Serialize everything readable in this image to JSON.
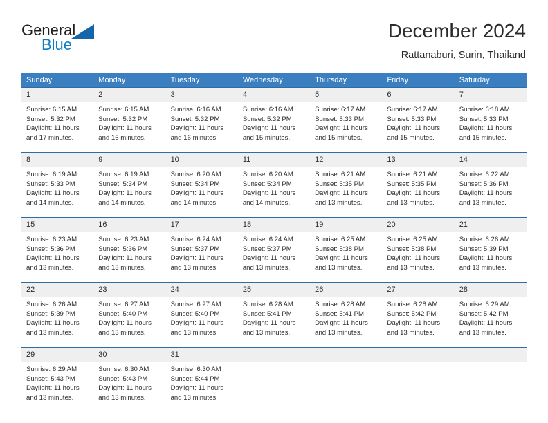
{
  "brand": {
    "line1": "General",
    "line2": "Blue",
    "accent_color": "#1565ab",
    "text_color": "#0f7dc2"
  },
  "header": {
    "title": "December 2024",
    "location": "Rattanaburi, Surin, Thailand"
  },
  "theme": {
    "header_bar_color": "#3b7fc0",
    "row_divider_color": "#2e6da4",
    "daynum_band_color": "#efefef"
  },
  "calendar": {
    "weekday_headers": [
      "Sunday",
      "Monday",
      "Tuesday",
      "Wednesday",
      "Thursday",
      "Friday",
      "Saturday"
    ],
    "weeks": [
      [
        {
          "day": "1",
          "sunrise": "Sunrise: 6:15 AM",
          "sunset": "Sunset: 5:32 PM",
          "daylight1": "Daylight: 11 hours",
          "daylight2": "and 17 minutes."
        },
        {
          "day": "2",
          "sunrise": "Sunrise: 6:15 AM",
          "sunset": "Sunset: 5:32 PM",
          "daylight1": "Daylight: 11 hours",
          "daylight2": "and 16 minutes."
        },
        {
          "day": "3",
          "sunrise": "Sunrise: 6:16 AM",
          "sunset": "Sunset: 5:32 PM",
          "daylight1": "Daylight: 11 hours",
          "daylight2": "and 16 minutes."
        },
        {
          "day": "4",
          "sunrise": "Sunrise: 6:16 AM",
          "sunset": "Sunset: 5:32 PM",
          "daylight1": "Daylight: 11 hours",
          "daylight2": "and 15 minutes."
        },
        {
          "day": "5",
          "sunrise": "Sunrise: 6:17 AM",
          "sunset": "Sunset: 5:33 PM",
          "daylight1": "Daylight: 11 hours",
          "daylight2": "and 15 minutes."
        },
        {
          "day": "6",
          "sunrise": "Sunrise: 6:17 AM",
          "sunset": "Sunset: 5:33 PM",
          "daylight1": "Daylight: 11 hours",
          "daylight2": "and 15 minutes."
        },
        {
          "day": "7",
          "sunrise": "Sunrise: 6:18 AM",
          "sunset": "Sunset: 5:33 PM",
          "daylight1": "Daylight: 11 hours",
          "daylight2": "and 15 minutes."
        }
      ],
      [
        {
          "day": "8",
          "sunrise": "Sunrise: 6:19 AM",
          "sunset": "Sunset: 5:33 PM",
          "daylight1": "Daylight: 11 hours",
          "daylight2": "and 14 minutes."
        },
        {
          "day": "9",
          "sunrise": "Sunrise: 6:19 AM",
          "sunset": "Sunset: 5:34 PM",
          "daylight1": "Daylight: 11 hours",
          "daylight2": "and 14 minutes."
        },
        {
          "day": "10",
          "sunrise": "Sunrise: 6:20 AM",
          "sunset": "Sunset: 5:34 PM",
          "daylight1": "Daylight: 11 hours",
          "daylight2": "and 14 minutes."
        },
        {
          "day": "11",
          "sunrise": "Sunrise: 6:20 AM",
          "sunset": "Sunset: 5:34 PM",
          "daylight1": "Daylight: 11 hours",
          "daylight2": "and 14 minutes."
        },
        {
          "day": "12",
          "sunrise": "Sunrise: 6:21 AM",
          "sunset": "Sunset: 5:35 PM",
          "daylight1": "Daylight: 11 hours",
          "daylight2": "and 13 minutes."
        },
        {
          "day": "13",
          "sunrise": "Sunrise: 6:21 AM",
          "sunset": "Sunset: 5:35 PM",
          "daylight1": "Daylight: 11 hours",
          "daylight2": "and 13 minutes."
        },
        {
          "day": "14",
          "sunrise": "Sunrise: 6:22 AM",
          "sunset": "Sunset: 5:36 PM",
          "daylight1": "Daylight: 11 hours",
          "daylight2": "and 13 minutes."
        }
      ],
      [
        {
          "day": "15",
          "sunrise": "Sunrise: 6:23 AM",
          "sunset": "Sunset: 5:36 PM",
          "daylight1": "Daylight: 11 hours",
          "daylight2": "and 13 minutes."
        },
        {
          "day": "16",
          "sunrise": "Sunrise: 6:23 AM",
          "sunset": "Sunset: 5:36 PM",
          "daylight1": "Daylight: 11 hours",
          "daylight2": "and 13 minutes."
        },
        {
          "day": "17",
          "sunrise": "Sunrise: 6:24 AM",
          "sunset": "Sunset: 5:37 PM",
          "daylight1": "Daylight: 11 hours",
          "daylight2": "and 13 minutes."
        },
        {
          "day": "18",
          "sunrise": "Sunrise: 6:24 AM",
          "sunset": "Sunset: 5:37 PM",
          "daylight1": "Daylight: 11 hours",
          "daylight2": "and 13 minutes."
        },
        {
          "day": "19",
          "sunrise": "Sunrise: 6:25 AM",
          "sunset": "Sunset: 5:38 PM",
          "daylight1": "Daylight: 11 hours",
          "daylight2": "and 13 minutes."
        },
        {
          "day": "20",
          "sunrise": "Sunrise: 6:25 AM",
          "sunset": "Sunset: 5:38 PM",
          "daylight1": "Daylight: 11 hours",
          "daylight2": "and 13 minutes."
        },
        {
          "day": "21",
          "sunrise": "Sunrise: 6:26 AM",
          "sunset": "Sunset: 5:39 PM",
          "daylight1": "Daylight: 11 hours",
          "daylight2": "and 13 minutes."
        }
      ],
      [
        {
          "day": "22",
          "sunrise": "Sunrise: 6:26 AM",
          "sunset": "Sunset: 5:39 PM",
          "daylight1": "Daylight: 11 hours",
          "daylight2": "and 13 minutes."
        },
        {
          "day": "23",
          "sunrise": "Sunrise: 6:27 AM",
          "sunset": "Sunset: 5:40 PM",
          "daylight1": "Daylight: 11 hours",
          "daylight2": "and 13 minutes."
        },
        {
          "day": "24",
          "sunrise": "Sunrise: 6:27 AM",
          "sunset": "Sunset: 5:40 PM",
          "daylight1": "Daylight: 11 hours",
          "daylight2": "and 13 minutes."
        },
        {
          "day": "25",
          "sunrise": "Sunrise: 6:28 AM",
          "sunset": "Sunset: 5:41 PM",
          "daylight1": "Daylight: 11 hours",
          "daylight2": "and 13 minutes."
        },
        {
          "day": "26",
          "sunrise": "Sunrise: 6:28 AM",
          "sunset": "Sunset: 5:41 PM",
          "daylight1": "Daylight: 11 hours",
          "daylight2": "and 13 minutes."
        },
        {
          "day": "27",
          "sunrise": "Sunrise: 6:28 AM",
          "sunset": "Sunset: 5:42 PM",
          "daylight1": "Daylight: 11 hours",
          "daylight2": "and 13 minutes."
        },
        {
          "day": "28",
          "sunrise": "Sunrise: 6:29 AM",
          "sunset": "Sunset: 5:42 PM",
          "daylight1": "Daylight: 11 hours",
          "daylight2": "and 13 minutes."
        }
      ],
      [
        {
          "day": "29",
          "sunrise": "Sunrise: 6:29 AM",
          "sunset": "Sunset: 5:43 PM",
          "daylight1": "Daylight: 11 hours",
          "daylight2": "and 13 minutes."
        },
        {
          "day": "30",
          "sunrise": "Sunrise: 6:30 AM",
          "sunset": "Sunset: 5:43 PM",
          "daylight1": "Daylight: 11 hours",
          "daylight2": "and 13 minutes."
        },
        {
          "day": "31",
          "sunrise": "Sunrise: 6:30 AM",
          "sunset": "Sunset: 5:44 PM",
          "daylight1": "Daylight: 11 hours",
          "daylight2": "and 13 minutes."
        },
        {
          "day": "",
          "sunrise": "",
          "sunset": "",
          "daylight1": "",
          "daylight2": ""
        },
        {
          "day": "",
          "sunrise": "",
          "sunset": "",
          "daylight1": "",
          "daylight2": ""
        },
        {
          "day": "",
          "sunrise": "",
          "sunset": "",
          "daylight1": "",
          "daylight2": ""
        },
        {
          "day": "",
          "sunrise": "",
          "sunset": "",
          "daylight1": "",
          "daylight2": ""
        }
      ]
    ]
  }
}
